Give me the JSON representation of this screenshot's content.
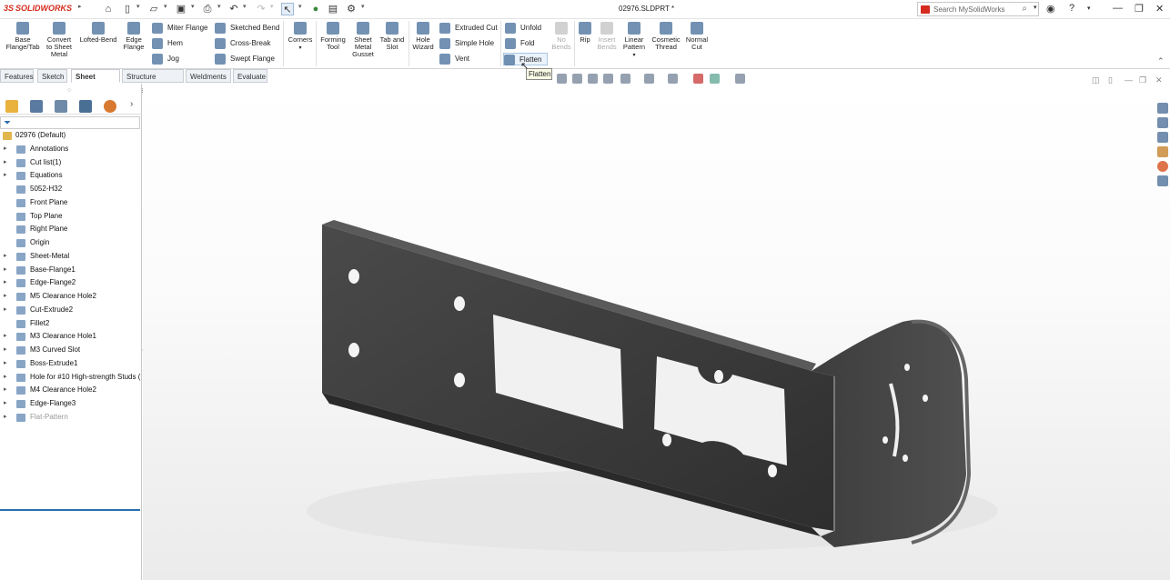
{
  "app": {
    "logo_text": "SOLIDWORKS",
    "doc_title": "02976.SLDPRT *"
  },
  "search": {
    "placeholder": "Search MySolidWorks"
  },
  "ribbon": {
    "buttons": {
      "base_flange": "Base\nFlange/Tab",
      "convert": "Convert\nto Sheet\nMetal",
      "lofted": "Lofted-Bend",
      "edge_flange": "Edge\nFlange",
      "corners": "Corners",
      "forming": "Forming\nTool",
      "gusset": "Sheet\nMetal\nGusset",
      "tab_slot": "Tab and\nSlot",
      "hole_wizard": "Hole\nWizard",
      "no_bends": "No\nBends",
      "rip": "Rip",
      "insert_bends": "Insert\nBends",
      "linear_pattern": "Linear\nPattern",
      "cosmetic_thread": "Cosmetic\nThread",
      "normal_cut": "Normal\nCut"
    },
    "small": {
      "miter": "Miter Flange",
      "hem": "Hem",
      "jog": "Jog",
      "sketched_bend": "Sketched Bend",
      "cross_break": "Cross-Break",
      "swept_flange": "Swept Flange",
      "extruded_cut": "Extruded Cut",
      "simple_hole": "Simple Hole",
      "vent": "Vent",
      "unfold": "Unfold",
      "fold": "Fold",
      "flatten": "Flatten"
    }
  },
  "tabs": [
    "Features",
    "Sketch",
    "Sheet Metal",
    "Structure System",
    "Weldments",
    "Evaluate"
  ],
  "tooltip": "Flatten",
  "tree": {
    "root": "02976  (Default)",
    "items": [
      {
        "label": "Annotations",
        "arrow": true
      },
      {
        "label": "Cut list(1)",
        "arrow": true
      },
      {
        "label": "Equations",
        "arrow": true
      },
      {
        "label": "5052-H32",
        "arrow": false
      },
      {
        "label": "Front Plane",
        "arrow": false
      },
      {
        "label": "Top Plane",
        "arrow": false
      },
      {
        "label": "Right Plane",
        "arrow": false
      },
      {
        "label": "Origin",
        "arrow": false
      },
      {
        "label": "Sheet-Metal",
        "arrow": true
      },
      {
        "label": "Base-Flange1",
        "arrow": true
      },
      {
        "label": "Edge-Flange2",
        "arrow": true
      },
      {
        "label": "M5 Clearance Hole2",
        "arrow": true
      },
      {
        "label": "Cut-Extrude2",
        "arrow": true
      },
      {
        "label": "Fillet2",
        "arrow": false
      },
      {
        "label": "M3 Clearance Hole1",
        "arrow": true
      },
      {
        "label": "M3 Curved Slot",
        "arrow": true
      },
      {
        "label": "Boss-Extrude1",
        "arrow": true
      },
      {
        "label": "Hole for #10 High-strength Studs (",
        "arrow": true
      },
      {
        "label": "M4 Clearance Hole2",
        "arrow": true
      },
      {
        "label": "Edge-Flange3",
        "arrow": true
      },
      {
        "label": "Flat-Pattern",
        "arrow": true,
        "grey": true
      }
    ]
  },
  "colors": {
    "brand": "#d52b1e",
    "accent": "#2a6fb0",
    "part": "#3a3a3a"
  }
}
